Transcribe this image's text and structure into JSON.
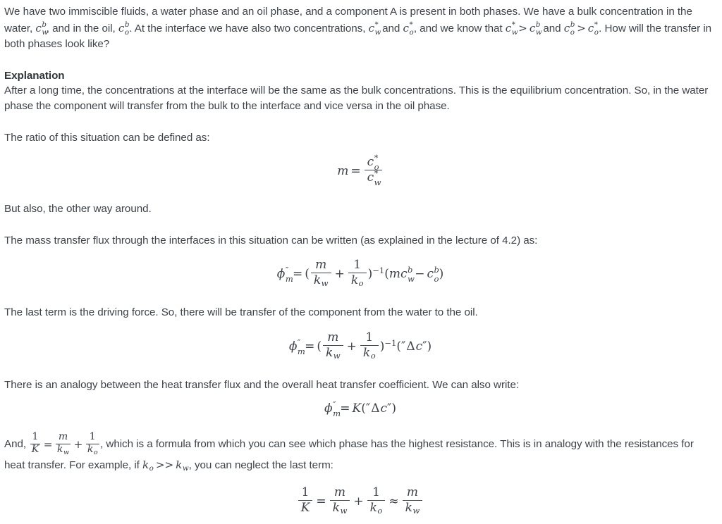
{
  "document": {
    "paragraph_1": {
      "part_a": "We have two immiscible fluids, a water phase and an oil phase, and a component A is present in both phases. We have a bulk concentration in the water, ",
      "var_cwb": "c",
      "var_cwb_sub": "w",
      "var_cwb_sup": "b",
      "part_b": ", and in the oil, ",
      "var_cob": "c",
      "var_cob_sub": "o",
      "var_cob_sup": "b",
      "part_c": ". At the interface we have also two concentrations, ",
      "var_cws": "c",
      "var_cws_sub": "w",
      "var_cws_sup": "*",
      "part_d": " and ",
      "var_cos": "c",
      "var_cos_sub": "o",
      "var_cos_sup": "*",
      "part_e": ", and we know that ",
      "ineq1_left": "c",
      "ineq1_left_sub": "w",
      "ineq1_left_sup": "*",
      "ineq1_op": ">",
      "ineq1_right": "c",
      "ineq1_right_sub": "w",
      "ineq1_right_sup": "b",
      "part_f": " and ",
      "ineq2_left": "c",
      "ineq2_left_sub": "o",
      "ineq2_left_sup": "b",
      "ineq2_op": ">",
      "ineq2_right": "c",
      "ineq2_right_sub": "o",
      "ineq2_right_sup": "*",
      "part_g": ". How will the transfer in both phases look like?"
    },
    "heading_explanation": "Explanation",
    "paragraph_2": "After a long time, the concentrations at the interface will be the same as the bulk concentrations. This is the equilibrium concentration. So, in the water phase the component will transfer from the bulk to the interface and vice versa in the oil phase.",
    "paragraph_3": "The ratio of this situation can be defined as:",
    "equation_1": {
      "lhs": "m",
      "rel": "=",
      "num_base": "c",
      "num_sub": "o",
      "num_sup": "*",
      "den_base": "c",
      "den_sub": "w",
      "den_sup": "*"
    },
    "paragraph_4": "But also, the other way around.",
    "paragraph_5": "The mass transfer flux through the interfaces in this situation can be written (as explained in the lecture of 4.2) as:",
    "equation_2": {
      "lhs_base": "ϕ",
      "lhs_sub": "m",
      "lhs_sup": "″",
      "rel": "=",
      "open_paren": "(",
      "frac1_num": "m",
      "frac1_den_base": "k",
      "frac1_den_sub": "w",
      "plus": "+",
      "frac2_num": "1",
      "frac2_den_base": "k",
      "frac2_den_sub": "o",
      "close_paren": ")",
      "exponent": "−1",
      "rhs_open": "(",
      "rhs_m": "m",
      "rhs_c1": "c",
      "rhs_c1_sub": "w",
      "rhs_c1_sup": "b",
      "rhs_minus": "−",
      "rhs_c2": "c",
      "rhs_c2_sub": "o",
      "rhs_c2_sup": "b",
      "rhs_close": ")"
    },
    "paragraph_6": "The last term is the driving force. So, there will be transfer of the component from the water to the oil.",
    "equation_3": {
      "lhs_base": "ϕ",
      "lhs_sub": "m",
      "lhs_sup": "″",
      "rel": "=",
      "open_paren": "(",
      "frac1_num": "m",
      "frac1_den_base": "k",
      "frac1_den_sub": "w",
      "plus": "+",
      "frac2_num": "1",
      "frac2_den_base": "k",
      "frac2_den_sub": "o",
      "close_paren": ")",
      "exponent": "−1",
      "rhs_open": "(",
      "rhs_quote_open": "″",
      "rhs_delta": "Δ",
      "rhs_c": "c",
      "rhs_quote_close": "″",
      "rhs_close": ")"
    },
    "paragraph_7": "There is an analogy between the heat transfer flux and the overall heat transfer coefficient. We can also write:",
    "equation_4": {
      "lhs_base": "ϕ",
      "lhs_sub": "m",
      "lhs_sup": "″",
      "rel": "=",
      "K": "K",
      "open_paren": "(",
      "quote_open": "″",
      "delta": "Δ",
      "c": "c",
      "quote_close": "″",
      "close_paren": ")"
    },
    "paragraph_8": {
      "part_a": "And, ",
      "frac_K_num": "1",
      "frac_K_den": "K",
      "rel": "=",
      "frac_m_num": "m",
      "frac_m_den_base": "k",
      "frac_m_den_sub": "w",
      "plus": "+",
      "frac_1_num": "1",
      "frac_1_den_base": "k",
      "frac_1_den_sub": "o",
      "part_b": ", which is a formula from which you can see which phase has the highest resistance. This is in analogy with the resistances for heat transfer. For example, if ",
      "ko_base": "k",
      "ko_sub": "o",
      "gg": ">>",
      "kw_base": "k",
      "kw_sub": "w",
      "part_c": ", you can neglect the last term:"
    },
    "equation_5": {
      "frac_K_num": "1",
      "frac_K_den": "K",
      "rel": "=",
      "frac_m_num": "m",
      "frac_m_den_base": "k",
      "frac_m_den_sub": "w",
      "plus": "+",
      "frac_1_num": "1",
      "frac_1_den_base": "k",
      "frac_1_den_sub": "o",
      "approx": "≈",
      "frac_last_num": "m",
      "frac_last_den_base": "k",
      "frac_last_den_sub": "w"
    }
  },
  "colors": {
    "text": "#3d4349",
    "heading": "#2f3438",
    "background": "#ffffff"
  }
}
